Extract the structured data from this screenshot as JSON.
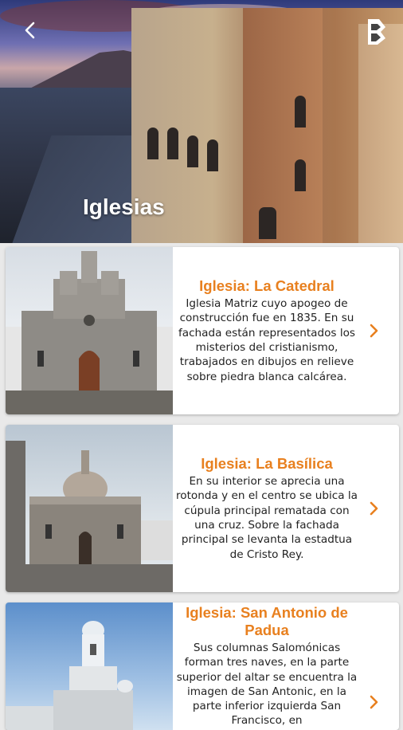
{
  "header": {
    "title": "Iglesias",
    "back_icon": "back-arrow-icon",
    "logo_icon": "app-logo-icon"
  },
  "churches": [
    {
      "title": "Iglesia: La Catedral",
      "description": "Iglesia Matriz cuyo apogeo de construcción fue en 1835. En su fachada están representados los misterios del cristianismo, trabajados en dibujos en relieve sobre piedra blanca calcárea."
    },
    {
      "title": "Iglesia: La Basílica",
      "description": "En su interior se aprecia una rotonda y en el centro se ubica la cúpula principal rematada con una cruz. Sobre la fachada principal se levanta la estadtua de Cristo Rey."
    },
    {
      "title": "Iglesia: San Antonio de Padua",
      "description": "Sus columnas Salomónicas forman tres naves, en la parte superior del altar se encuentra la imagen de San Antonic, en la parte inferior izquierda San Francisco, en"
    }
  ],
  "colors": {
    "accent": "#e8801f",
    "text": "#222222",
    "background": "#e9e9e9"
  }
}
